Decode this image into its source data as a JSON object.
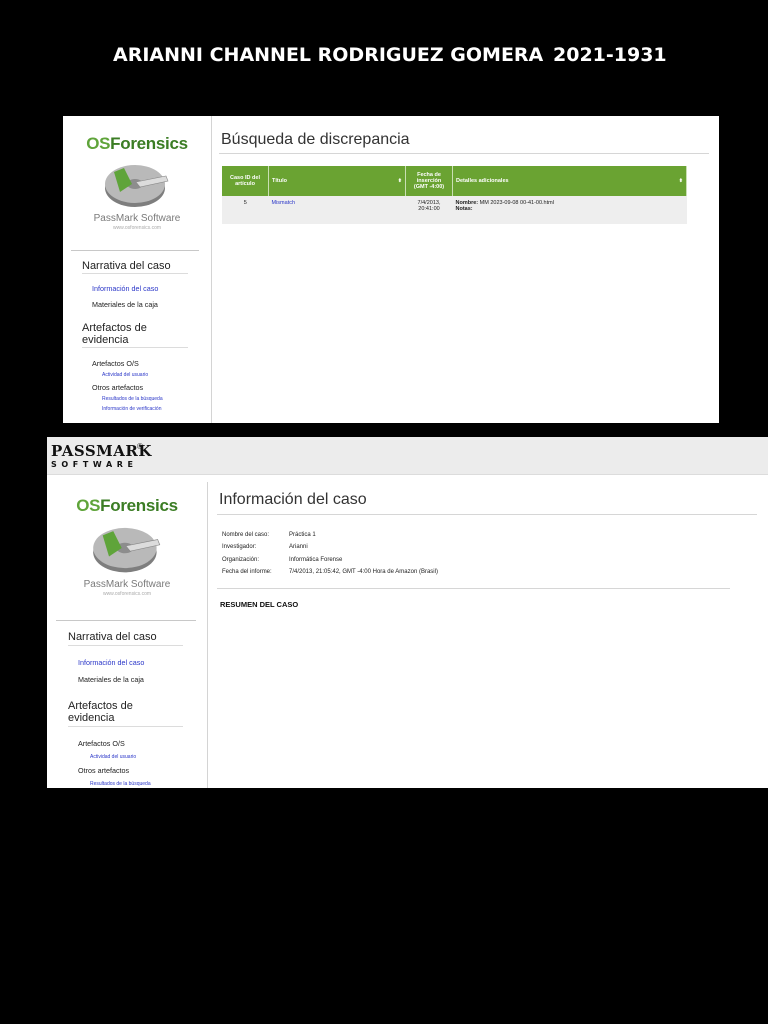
{
  "header": {
    "author_name": "ARIANNI CHANNEL RODRIGUEZ GOMERA",
    "student_id": "2021-1931"
  },
  "passmark_bar": {
    "brand": "PASSMARK",
    "sub": "SOFTWARE",
    "reg": "®"
  },
  "branding": {
    "os": "OS",
    "forensics": "Forensics",
    "vendor": "PassMark Software",
    "url": "www.osforensics.com"
  },
  "sidebar": {
    "narrativa_heading": "Narrativa del caso",
    "info_caso": "Información del caso",
    "materiales": "Materiales de la caja",
    "artefactos_heading": "Artefactos de evidencia",
    "artefactos_os": "Artefactos O/S",
    "actividad_usuario": "Actividad del usuario",
    "otros_artefactos": "Otros artefactos",
    "resultados_busqueda": "Resultados de la búsqueda",
    "info_verificacion": "Información de verificación"
  },
  "shot1": {
    "title": "Búsqueda de discrepancia",
    "table": {
      "headers": [
        "Caso ID del artículo",
        "Título",
        "Fecha de inserción (GMT -4:00)",
        "Detalles adicionales"
      ],
      "rows": [
        {
          "id": "5",
          "titulo": "Mismatch",
          "fecha": "7/4/2013, 20:41:00",
          "detalle_label": "Nombre:",
          "detalle_value": "MM 2023-09-08 00-41-00.html",
          "notas_label": "Notas:"
        }
      ]
    }
  },
  "shot2": {
    "title": "Información del caso",
    "fields": [
      {
        "label": "Nombre del caso:",
        "value": "Práctica 1"
      },
      {
        "label": "Investigador:",
        "value": "Arianni"
      },
      {
        "label": "Organización:",
        "value": "Informática Forense"
      },
      {
        "label": "Fecha del informe:",
        "value": "7/4/2013, 21:05:42, GMT -4:00 Hora de Amazon (Brasil)"
      }
    ],
    "summary_heading": "RESUMEN DEL CASO"
  },
  "colors": {
    "green_header": "#6aa332",
    "link_blue": "#2a36c8",
    "logo_green": "#5fa43a"
  },
  "icons": [
    "hard-disk-icon",
    "sort-icon"
  ]
}
